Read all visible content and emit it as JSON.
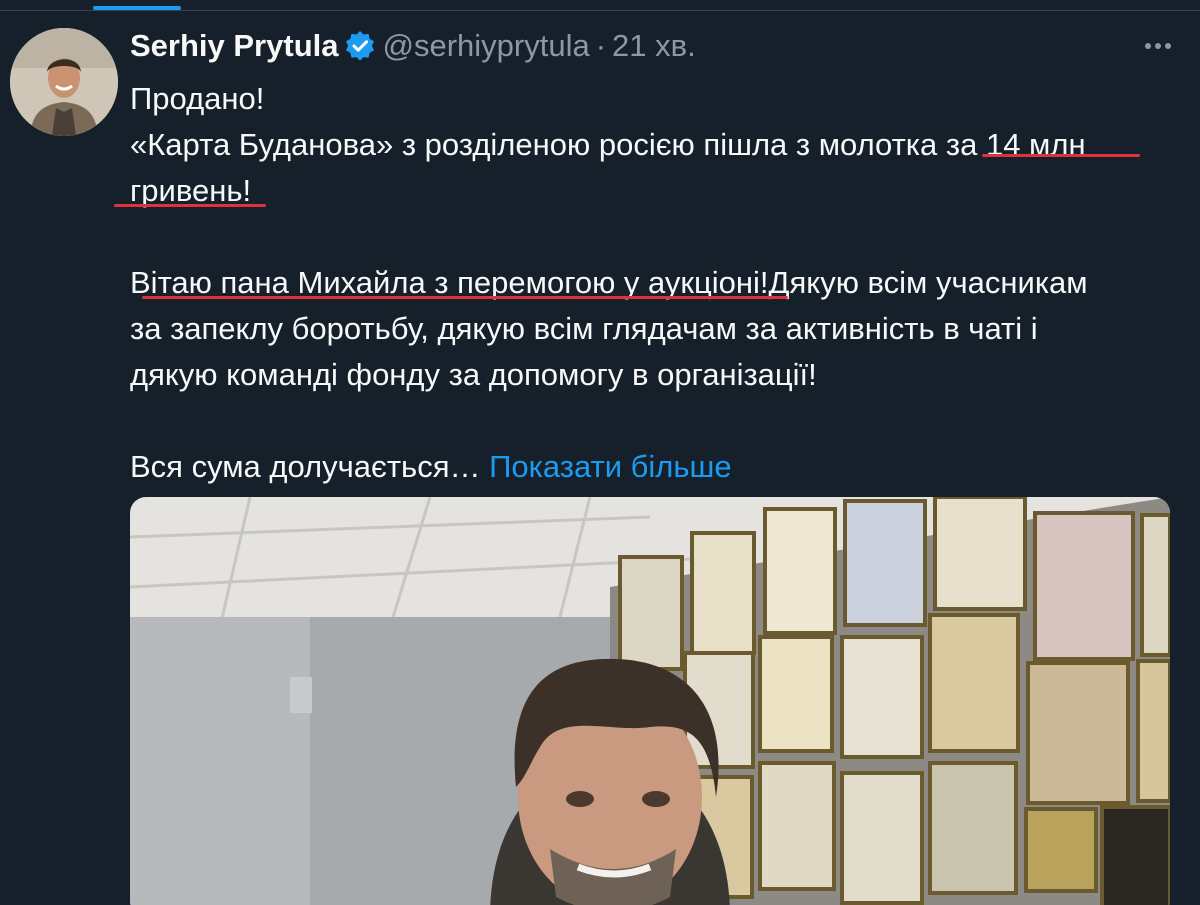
{
  "tweet": {
    "author_name": "Serhiy Prytula",
    "handle": "@serhiyprytula",
    "separator": "·",
    "time": "21 хв.",
    "icons": {
      "verified": "verified-badge-icon",
      "more": "more-icon"
    },
    "colors": {
      "background": "#15202b",
      "text": "#f7f9f9",
      "muted": "#8b98a5",
      "link": "#1d9bf0",
      "annotation_underline": "#e0323d"
    },
    "text_lines": {
      "l1": "Продано!",
      "l2": "«Карта Буданова» з розділеною росією пішла з молотка за 14 млн",
      "l3": "гривень!",
      "l4": "Вітаю пана Михайла з перемогою у аукціоні!Дякую всім учасникам",
      "l5": "за запеклу боротьбу, дякую всім глядачам за активність в чаті і",
      "l6": "дякую команді фонду за допомогу в організації!",
      "l7": "Вся сума долучається…"
    },
    "show_more": "Показати більше",
    "media": "photo of man in office with framed certificates on wall"
  }
}
